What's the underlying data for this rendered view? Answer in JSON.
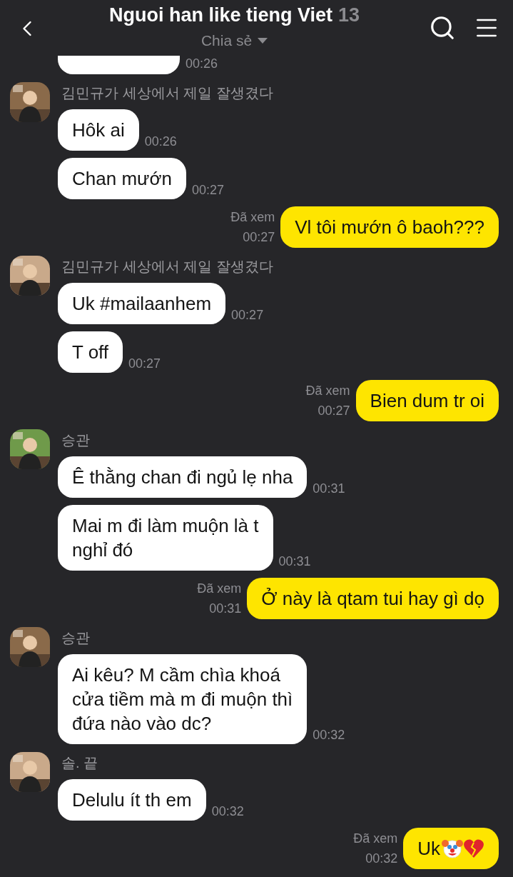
{
  "header": {
    "title": "Nguoi han like tieng Viet",
    "member_count": "13",
    "subtitle": "Chia sẻ"
  },
  "messages": [
    {
      "kind": "cut",
      "time": "00:26"
    },
    {
      "kind": "group",
      "sender": "김민규가 세상에서 제일 잘생겼다",
      "bubbles": [
        {
          "text": "Hôk ai",
          "time": "00:26"
        },
        {
          "text": "Chan mướn",
          "time": "00:27"
        }
      ]
    },
    {
      "kind": "own",
      "read": "Đã xem",
      "time": "00:27",
      "text": "Vl tôi mướn ô baoh???"
    },
    {
      "kind": "group",
      "sender": "김민규가 세상에서 제일 잘생겼다",
      "bubbles": [
        {
          "text": "Uk #mailaanhem",
          "time": "00:27"
        },
        {
          "text": "T off",
          "time": "00:27"
        }
      ]
    },
    {
      "kind": "own",
      "read": "Đã xem",
      "time": "00:27",
      "text": "Bien dum tr oi"
    },
    {
      "kind": "group",
      "sender": "승관",
      "bubbles": [
        {
          "text": "Ê thằng chan đi ngủ lẹ nha",
          "time": "00:31"
        },
        {
          "text": "Mai m đi làm muộn là t\nnghỉ đó",
          "time": "00:31"
        }
      ]
    },
    {
      "kind": "own",
      "read": "Đã xem",
      "time": "00:31",
      "text": "Ở này là qtam tui hay gì dọ"
    },
    {
      "kind": "group",
      "sender": "승관",
      "bubbles": [
        {
          "text": "Ai kêu? M cầm chìa khoá\ncửa tiềm mà m đi muộn thì\nđứa nào vào dc?",
          "time": "00:32"
        }
      ]
    },
    {
      "kind": "group",
      "sender": "솔. 끝",
      "bubbles": [
        {
          "text": "Delulu ít th em",
          "time": "00:32"
        }
      ]
    },
    {
      "kind": "own-emoji",
      "read": "Đã xem",
      "time": "00:32",
      "text": "Uk"
    }
  ]
}
